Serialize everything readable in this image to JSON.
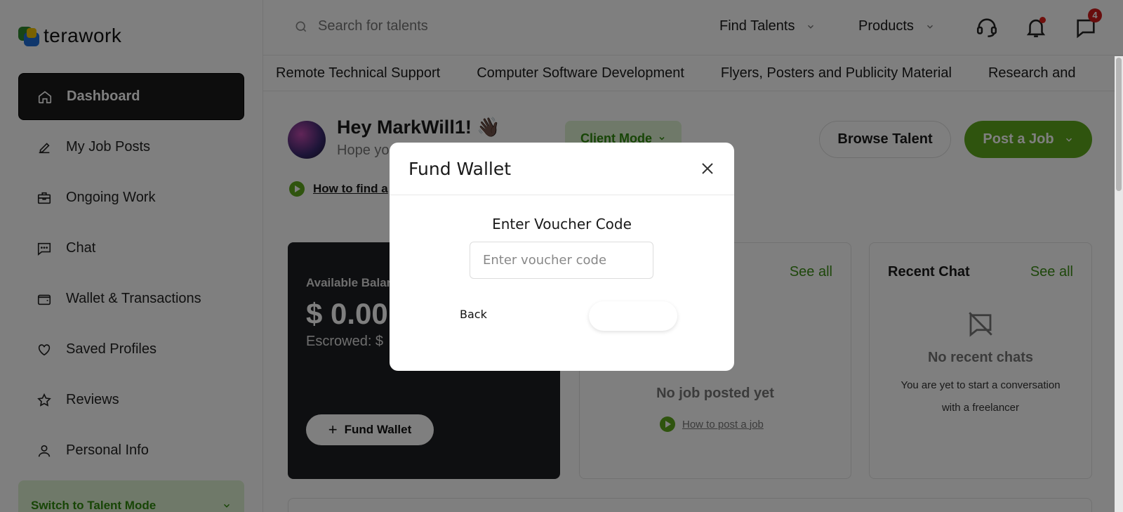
{
  "brand": {
    "name": "terawork"
  },
  "sidebar": {
    "items": [
      {
        "label": "Dashboard",
        "icon": "home-icon",
        "active": true
      },
      {
        "label": "My Job Posts",
        "icon": "pencil-icon"
      },
      {
        "label": "Ongoing Work",
        "icon": "briefcase-icon"
      },
      {
        "label": "Chat",
        "icon": "chat-icon"
      },
      {
        "label": "Wallet & Transactions",
        "icon": "wallet-icon"
      },
      {
        "label": "Saved Profiles",
        "icon": "heart-icon"
      },
      {
        "label": "Reviews",
        "icon": "star-icon"
      },
      {
        "label": "Personal Info",
        "icon": "user-icon"
      }
    ],
    "switch_mode": "Switch to Talent Mode"
  },
  "header": {
    "search_placeholder": "Search for talents",
    "find_talents": "Find Talents",
    "products": "Products",
    "message_badge": "4"
  },
  "categories": [
    "Remote Technical Support",
    "Computer Software Development",
    "Flyers, Posters and Publicity Material",
    "Research and"
  ],
  "main": {
    "greeting": "Hey MarkWill1! 👋🏿",
    "subgreeting": "Hope yo",
    "client_mode": "Client Mode",
    "browse_talent": "Browse Talent",
    "post_job": "Post a Job",
    "howto_link": "How to find a",
    "wallet": {
      "label": "Available Balan",
      "amount": "$ 0.00",
      "escrowed": "Escrowed: $",
      "fund_button": "Fund Wallet"
    },
    "jobs_card": {
      "see_all": "See all",
      "empty_title": "No job posted yet",
      "howto": "How to post a job"
    },
    "chat_card": {
      "title": "Recent Chat",
      "see_all": "See all",
      "empty_title": "No recent chats",
      "empty_text": "You are yet to start a conversation with a freelancer"
    }
  },
  "modal": {
    "title": "Fund Wallet",
    "voucher_label": "Enter Voucher Code",
    "voucher_placeholder": "Enter voucher code",
    "voucher_value": "",
    "back": "Back"
  },
  "colors": {
    "accent": "#5ea81c",
    "accent_light": "#dff3d2",
    "dark": "#1b1b1b"
  }
}
